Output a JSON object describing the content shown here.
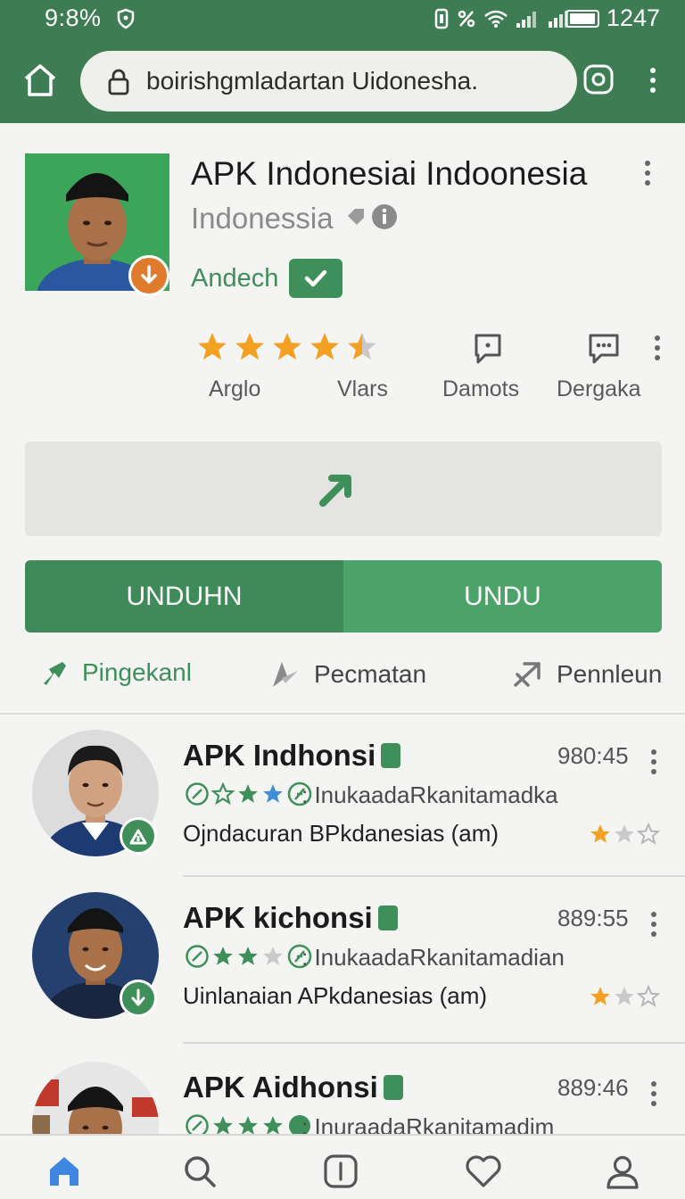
{
  "status_bar": {
    "time": "9:8%",
    "battery_level": "1247"
  },
  "browser": {
    "url": "boirishgmladartan Uidonesha."
  },
  "app": {
    "title": "APK Indonesiai Indoonesia",
    "subtitle": "Indonessia",
    "developer": "Andech",
    "rating_stars": 4.5,
    "colors": {
      "accent": "#3e8f59",
      "accent_light": "#4ba36a",
      "orange_badge": "#e07a2c"
    }
  },
  "stats": [
    {
      "label": "Arglo"
    },
    {
      "label": "Vlars"
    },
    {
      "label": "Damots",
      "icon": "comment-icon"
    },
    {
      "label": "Dergaka",
      "icon": "chat-icon"
    }
  ],
  "buttons": {
    "left_label": "UNDUHN",
    "right_label": "UNDU"
  },
  "actions": [
    {
      "label": "Pingekanl",
      "icon": "share-icon"
    },
    {
      "label": "Pecmatan",
      "icon": "lookup-icon"
    },
    {
      "label": "Pennleun",
      "icon": "forward-icon"
    }
  ],
  "list": [
    {
      "title": "APK Indhonsi",
      "time": "980:45",
      "subtitle": ": InukaadaRkanitamadka",
      "description": "Ojndacuran BPkdanesias (am)",
      "badge_icon": "install-icon",
      "rating": 1.5
    },
    {
      "title": "APK kichonsi",
      "time": "889:55",
      "subtitle": ": InukaadaRkanitamadian",
      "description": "Uinlanaian APkdanesias (am)",
      "badge_icon": "download-icon",
      "rating": 1.5
    },
    {
      "title": "APK Aidhonsi",
      "time": "889:46",
      "subtitle": ": InuraadaRkanitamadim",
      "description": "",
      "badge_icon": "",
      "rating": 0
    }
  ],
  "bottom_nav": [
    {
      "icon": "home-icon",
      "active": true
    },
    {
      "icon": "search-icon",
      "active": false
    },
    {
      "icon": "info-icon",
      "active": false
    },
    {
      "icon": "heart-icon",
      "active": false
    },
    {
      "icon": "profile-icon",
      "active": false
    }
  ]
}
